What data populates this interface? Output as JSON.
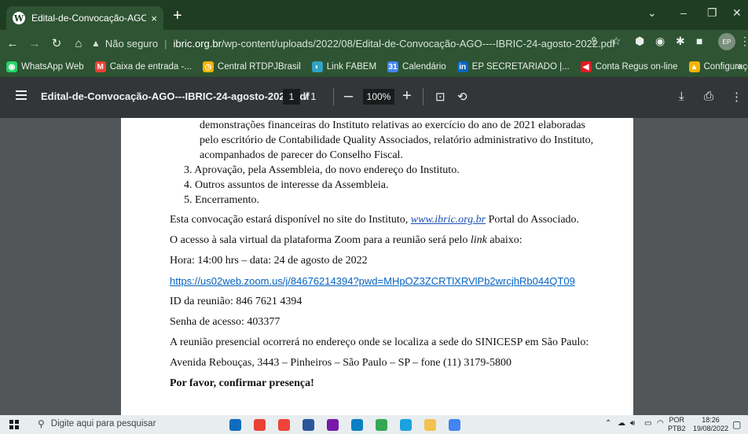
{
  "browser": {
    "tab_title": "Edital-de-Convocação-AGO---IB",
    "tab_close": "×",
    "new_tab": "+",
    "window_controls": [
      "⌄",
      "–",
      "❐",
      "✕"
    ],
    "security_label": "Não seguro",
    "url_host": "ibric.org.br",
    "url_path": "/wp-content/uploads/2022/08/Edital-de-Convocação-AGO----IBRIC-24-agosto-2022.pdf",
    "avatar_text": "EP"
  },
  "bookmarks": [
    {
      "label": "WhatsApp Web",
      "color": "#25d366",
      "glyph": "◉"
    },
    {
      "label": "Caixa de entrada -...",
      "color": "#ea4335",
      "glyph": "M"
    },
    {
      "label": "Central RTDPJBrasil",
      "color": "#f4b400",
      "glyph": "◷"
    },
    {
      "label": "Link FABEM",
      "color": "#2ea3c7",
      "glyph": "◐"
    },
    {
      "label": "Calendário",
      "color": "#4285f4",
      "glyph": "31"
    },
    {
      "label": "EP SECRETARIADO |...",
      "color": "#0a66c2",
      "glyph": "in"
    },
    {
      "label": "Conta Regus on-line",
      "color": "#e31b23",
      "glyph": "◀"
    },
    {
      "label": "Configurações | Jus...",
      "color": "#f4b400",
      "glyph": "▲"
    }
  ],
  "bookmarks_more": "»",
  "pdf_viewer": {
    "title": "Edital-de-Convocação-AGO---IBRIC-24-agosto-2022.pdf",
    "current_page": "1",
    "page_separator": "/",
    "total_pages": "1",
    "zoom": "100%",
    "zoom_out": "–",
    "zoom_in": "+"
  },
  "document": {
    "item2_lines": [
      "demonstrações financeiras do Instituto relativas ao exercício do ano de 2021 elaboradas",
      "pelo escritório de Contabilidade Quality Associados, relatório administrativo do Instituto,",
      "acompanhados de parecer do Conselho Fiscal."
    ],
    "item3": "3.   Aprovação, pela Assembleia, do novo endereço do Instituto.",
    "item4": "4.   Outros assuntos de interesse da Assembleia.",
    "item5": "5.   Encerramento.",
    "site_prefix": "Esta convocação estará disponível no site do Instituto, ",
    "site_link": "www.ibric.org.br",
    "site_suffix": " Portal do Associado.",
    "zoom_prefix": "O acesso à sala virtual da plataforma Zoom para a reunião será pelo ",
    "zoom_link_word": "link",
    "zoom_suffix": " abaixo:",
    "date_time": "Hora: 14:00 hrs – data: 24 de agosto de 2022",
    "meeting_url": "https://us02web.zoom.us/j/84676214394?pwd=MHpOZ3ZCRTlXRVlPb2wrcjhRb044QT09",
    "meeting_id": "ID da reunião: 846 7621 4394",
    "passcode": "Senha de acesso: 403377",
    "presential": "A reunião presencial ocorrerá no endereço onde se localiza a sede do SINICESP em São Paulo:",
    "address": "Avenida Rebouças, 3443 – Pinheiros – São Paulo – SP – fone (11) 3179-5800",
    "confirm": "Por favor, confirmar presença!"
  },
  "taskbar": {
    "search_placeholder": "Digite aqui para pesquisar",
    "lang_top": "POR",
    "lang_bottom": "PTB2",
    "time": "18:26",
    "date": "19/08/2022",
    "apps": [
      {
        "name": "outlook",
        "color": "#0f6cbd"
      },
      {
        "name": "chrome",
        "color": "#e94235"
      },
      {
        "name": "anydesk",
        "color": "#ef443b"
      },
      {
        "name": "word",
        "color": "#2b579a"
      },
      {
        "name": "onenote",
        "color": "#7719aa"
      },
      {
        "name": "photos",
        "color": "#0a7fc2"
      },
      {
        "name": "chrome-2",
        "color": "#34a853"
      },
      {
        "name": "edge",
        "color": "#1ba2de"
      },
      {
        "name": "explorer",
        "color": "#f2c14e"
      },
      {
        "name": "chrome-3",
        "color": "#4285f4"
      }
    ]
  },
  "colors": {
    "frame": "#2e5433",
    "tabstrip": "#1f3d22",
    "pdf_toolbar": "#323639",
    "pdf_background": "#525659"
  }
}
